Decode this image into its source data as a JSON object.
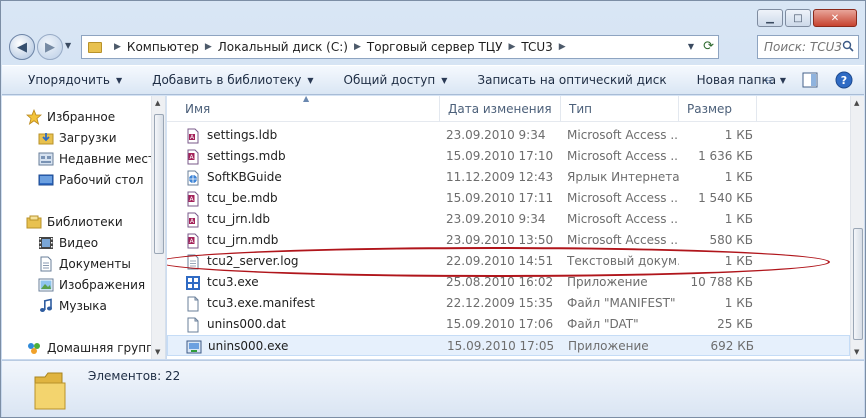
{
  "window": {
    "caption_buttons": {
      "minimize": "▁",
      "maximize": "□",
      "close": "✕"
    }
  },
  "address": {
    "breadcrumbs": [
      "Компьютер",
      "Локальный диск (C:)",
      "Торговый сервер ТЦУ",
      "TCU3"
    ],
    "search_placeholder": "Поиск: TCU3"
  },
  "toolbar": {
    "organize": "Упорядочить",
    "add_to_library": "Добавить в библиотеку",
    "share": "Общий доступ",
    "burn": "Записать на оптический диск",
    "new_folder": "Новая папка"
  },
  "nav": {
    "favorites": "Избранное",
    "downloads": "Загрузки",
    "recent": "Недавние места",
    "desktop": "Рабочий стол",
    "libraries": "Библиотеки",
    "videos": "Видео",
    "documents": "Документы",
    "pictures": "Изображения",
    "music": "Музыка",
    "homegroup": "Домашняя группа"
  },
  "columns": {
    "name": "Имя",
    "date": "Дата изменения",
    "type": "Тип",
    "size": "Размер"
  },
  "files": [
    {
      "name": "settings.ldb",
      "date": "23.09.2010 9:34",
      "type": "Microsoft Access ...",
      "size": "1 КБ",
      "icon": "access-lock-icon"
    },
    {
      "name": "settings.mdb",
      "date": "15.09.2010 17:10",
      "type": "Microsoft Access ...",
      "size": "1 636 КБ",
      "icon": "access-db-icon"
    },
    {
      "name": "SoftKBGuide",
      "date": "11.12.2009 12:43",
      "type": "Ярлык Интернета",
      "size": "1 КБ",
      "icon": "internet-shortcut-icon"
    },
    {
      "name": "tcu_be.mdb",
      "date": "15.09.2010 17:11",
      "type": "Microsoft Access ...",
      "size": "1 540 КБ",
      "icon": "access-db-icon"
    },
    {
      "name": "tcu_jrn.ldb",
      "date": "23.09.2010 9:34",
      "type": "Microsoft Access ...",
      "size": "1 КБ",
      "icon": "access-lock-icon"
    },
    {
      "name": "tcu_jrn.mdb",
      "date": "23.09.2010 13:50",
      "type": "Microsoft Access ...",
      "size": "580 КБ",
      "icon": "access-db-icon"
    },
    {
      "name": "tcu2_server.log",
      "date": "22.09.2010 14:51",
      "type": "Текстовый докум...",
      "size": "1 КБ",
      "icon": "text-file-icon"
    },
    {
      "name": "tcu3.exe",
      "date": "25.08.2010 16:02",
      "type": "Приложение",
      "size": "10 788 КБ",
      "icon": "application-icon"
    },
    {
      "name": "tcu3.exe.manifest",
      "date": "22.12.2009 15:35",
      "type": "Файл \"MANIFEST\"",
      "size": "1 КБ",
      "icon": "blank-file-icon"
    },
    {
      "name": "unins000.dat",
      "date": "15.09.2010 17:06",
      "type": "Файл \"DAT\"",
      "size": "25 КБ",
      "icon": "blank-file-icon"
    },
    {
      "name": "unins000.exe",
      "date": "15.09.2010 17:05",
      "type": "Приложение",
      "size": "692 КБ",
      "icon": "installer-icon"
    }
  ],
  "details": {
    "items_count": "Элементов: 22"
  },
  "colors": {
    "highlight_ring": "#b0151b",
    "selection": "#e6f0fc",
    "window_frame": "#c7d8ee"
  }
}
